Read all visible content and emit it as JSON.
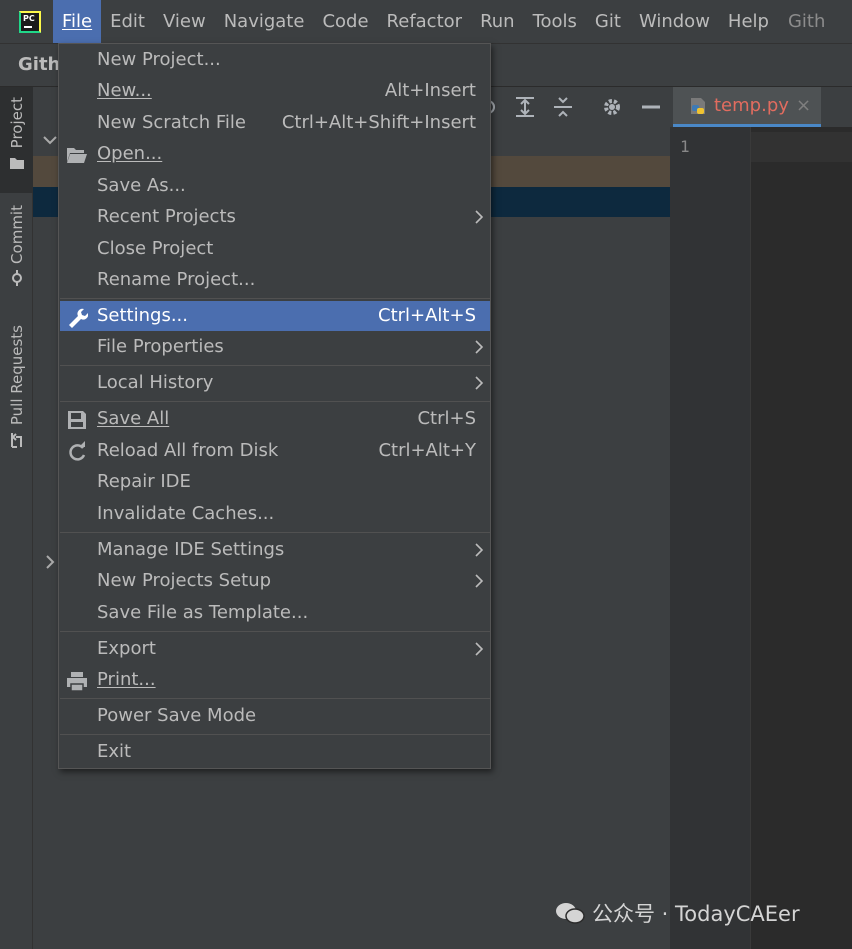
{
  "menubar": {
    "items": [
      {
        "label": "File",
        "ul": "F",
        "rest": "ile",
        "active": true
      },
      {
        "label": "Edit",
        "ul": "E",
        "rest": "dit"
      },
      {
        "label": "View",
        "ul": "V",
        "rest": "iew"
      },
      {
        "label": "Navigate",
        "ul": "N",
        "rest": "avigate"
      },
      {
        "label": "Code",
        "ul": "C",
        "rest": "ode"
      },
      {
        "label": "Refactor",
        "ul": "R",
        "rest": "efactor"
      },
      {
        "label": "Run",
        "ul": "",
        "rest": "Run"
      },
      {
        "label": "Tools",
        "ul": "T",
        "rest": "ools"
      },
      {
        "label": "Git",
        "ul": "G",
        "rest": "it"
      },
      {
        "label": "Window",
        "ul": "W",
        "rest": "indow"
      },
      {
        "label": "Help",
        "ul": "H",
        "rest": "elp"
      }
    ],
    "title_fragment": "Gith"
  },
  "toolbar": {
    "breadcrumb": "Githu"
  },
  "toolstrip": {
    "project": "Project",
    "commit": "Commit",
    "pull_requests": "Pull Requests"
  },
  "editor": {
    "tab_name": "temp.py",
    "tab_close": "×",
    "line_number": "1"
  },
  "file_menu": {
    "new_project": "New Project...",
    "new": "New...",
    "new_shortcut": "Alt+Insert",
    "new_scratch": "New Scratch File",
    "new_scratch_shortcut": "Ctrl+Alt+Shift+Insert",
    "open": "Open...",
    "save_as": "Save As...",
    "recent_projects": "Recent Projects",
    "close_project": "Close Project",
    "rename_project": "Rename Project...",
    "settings": "Settings...",
    "settings_shortcut": "Ctrl+Alt+S",
    "file_properties": "File Properties",
    "local_history": "Local History",
    "save_all": "Save All",
    "save_all_shortcut": "Ctrl+S",
    "reload": "Reload All from Disk",
    "reload_shortcut": "Ctrl+Alt+Y",
    "repair_ide": "Repair IDE",
    "invalidate_caches": "Invalidate Caches...",
    "manage_ide_settings": "Manage IDE Settings",
    "new_projects_setup": "New Projects Setup",
    "save_file_template": "Save File as Template...",
    "export": "Export",
    "print": "Print...",
    "power_save": "Power Save Mode",
    "exit": "Exit"
  },
  "watermark": "公众号 · TodayCAEer",
  "colors": {
    "highlight": "#4b6eaf",
    "menubar_bg": "#3c3f41",
    "editor_bg": "#2b2b2b",
    "tab_name": "#e16c5f"
  }
}
